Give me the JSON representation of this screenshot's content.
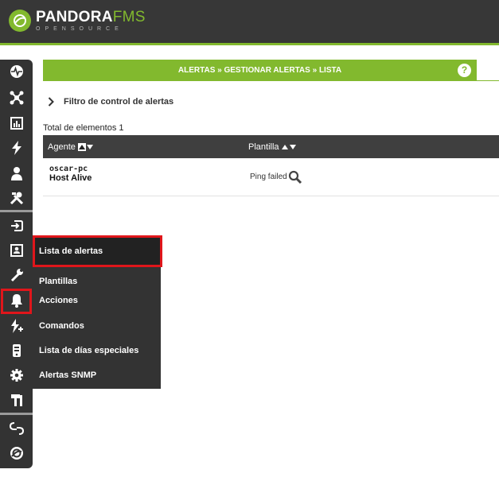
{
  "header": {
    "logo_main": "PANDORA",
    "logo_accent": "FMS",
    "logo_sub": "OPENSOURCE"
  },
  "breadcrumb": {
    "text": "ALERTAS » GESTIONAR ALERTAS » LISTA",
    "help": "?"
  },
  "filter": {
    "label": "Filtro de control de alertas"
  },
  "total": "Total de elementos 1",
  "table": {
    "columns": [
      "Agente",
      "Plantilla"
    ],
    "rows": [
      {
        "agent": "oscar-pc",
        "module": "Host Alive",
        "template": "Ping failed"
      }
    ]
  },
  "flyout": {
    "items": [
      "Lista de alertas",
      "Plantillas",
      "Acciones",
      "Comandos",
      "Lista de días especiales",
      "Alertas SNMP"
    ]
  },
  "sidebar": {
    "icons": [
      "monitoring-icon",
      "network-topology-icon",
      "reports-icon",
      "events-icon",
      "users-icon",
      "tools-icon",
      "login-icon",
      "user-card-icon",
      "wrench-icon",
      "alerts-bell-icon",
      "alert-bolt-icon",
      "device-icon",
      "settings-gear-icon",
      "admin-tools-icon",
      "links-icon",
      "pandora-icon"
    ]
  },
  "colors": {
    "brand_green": "#82b92e",
    "header_dark": "#373737",
    "sidebar": "#333333",
    "highlight_red": "#e0161b"
  }
}
